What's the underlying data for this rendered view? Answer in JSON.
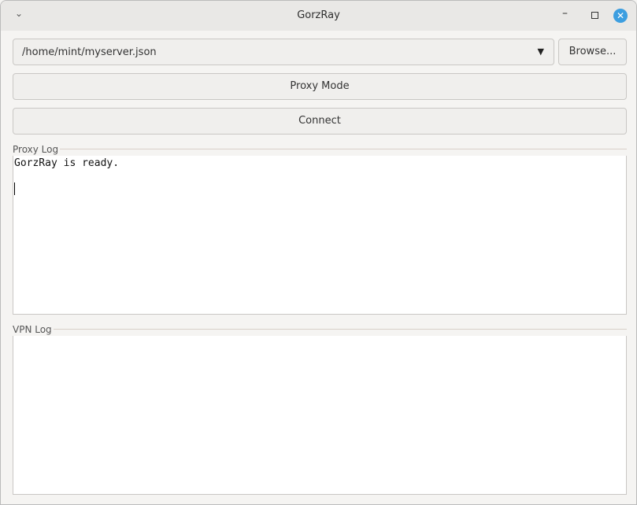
{
  "window": {
    "title": "GorzRay"
  },
  "toolbar": {
    "config_path": "/home/mint/myserver.json",
    "browse_label": "Browse...",
    "proxy_mode_label": "Proxy Mode",
    "connect_label": "Connect"
  },
  "proxy_log": {
    "label": "Proxy Log",
    "text": "GorzRay is ready."
  },
  "vpn_log": {
    "label": "VPN Log",
    "text": ""
  }
}
